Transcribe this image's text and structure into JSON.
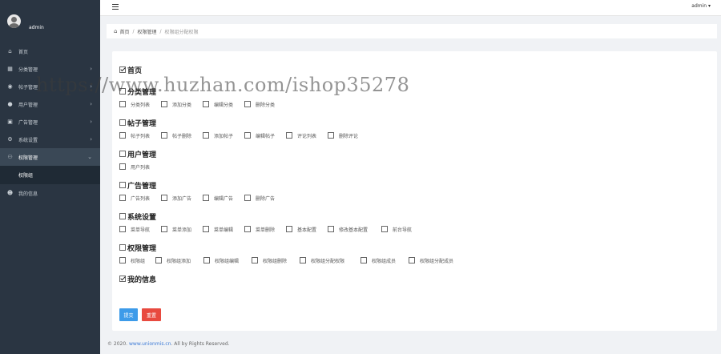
{
  "sidebar": {
    "username": "admin",
    "items": [
      {
        "label": "首页",
        "icon": "home-icon",
        "arrow": ""
      },
      {
        "label": "分类管理",
        "icon": "grid-icon",
        "arrow": "›"
      },
      {
        "label": "帖子管理",
        "icon": "car-icon",
        "arrow": "›"
      },
      {
        "label": "用户管理",
        "icon": "user-icon",
        "arrow": "›"
      },
      {
        "label": "广告管理",
        "icon": "image-icon",
        "arrow": "›"
      },
      {
        "label": "系统设置",
        "icon": "gear-icon",
        "arrow": "›"
      },
      {
        "label": "权限管理",
        "icon": "users-icon",
        "arrow": "⌄"
      }
    ],
    "active_sub": "权限组",
    "last_item": {
      "label": "我的信息",
      "icon": "user-cog-icon"
    }
  },
  "header": {
    "admin_label": "admin ▾"
  },
  "breadcrumb": {
    "home": "首页",
    "section": "权限管理",
    "current": "权限组分配权限"
  },
  "permissions": [
    {
      "title": "首页",
      "checked": true,
      "items": []
    },
    {
      "title": "分类管理",
      "checked": false,
      "items": [
        "分类列表",
        "添加分类",
        "编辑分类",
        "删除分类"
      ]
    },
    {
      "title": "帖子管理",
      "checked": false,
      "items": [
        "帖子列表",
        "帖子删除",
        "添加帖子",
        "编辑帖子",
        "评论列表",
        "删除评论"
      ]
    },
    {
      "title": "用户管理",
      "checked": false,
      "items": [
        "用户列表"
      ]
    },
    {
      "title": "广告管理",
      "checked": false,
      "items": [
        "广告列表",
        "添加广告",
        "编辑广告",
        "删除广告"
      ]
    },
    {
      "title": "系统设置",
      "checked": false,
      "items": [
        "菜单导航",
        "菜单添加",
        "菜单编辑",
        "菜单删除",
        "基本配置",
        "修改基本配置",
        "前台导航"
      ]
    },
    {
      "title": "权限管理",
      "checked": false,
      "items": [
        "权限组",
        "权限组添加",
        "权限组编辑",
        "权限组删除",
        "权限组分配权限",
        "权限组成员",
        "权限组分配成员"
      ]
    },
    {
      "title": "我的信息",
      "checked": true,
      "items": []
    }
  ],
  "buttons": {
    "submit": "提交",
    "reset": "重置"
  },
  "footer": {
    "prefix": "© 2020. ",
    "link": "www.unionmis.cn",
    "suffix": ". All by Rights Reserved."
  },
  "watermark": "https://www.huzhan.com/ishop35278"
}
